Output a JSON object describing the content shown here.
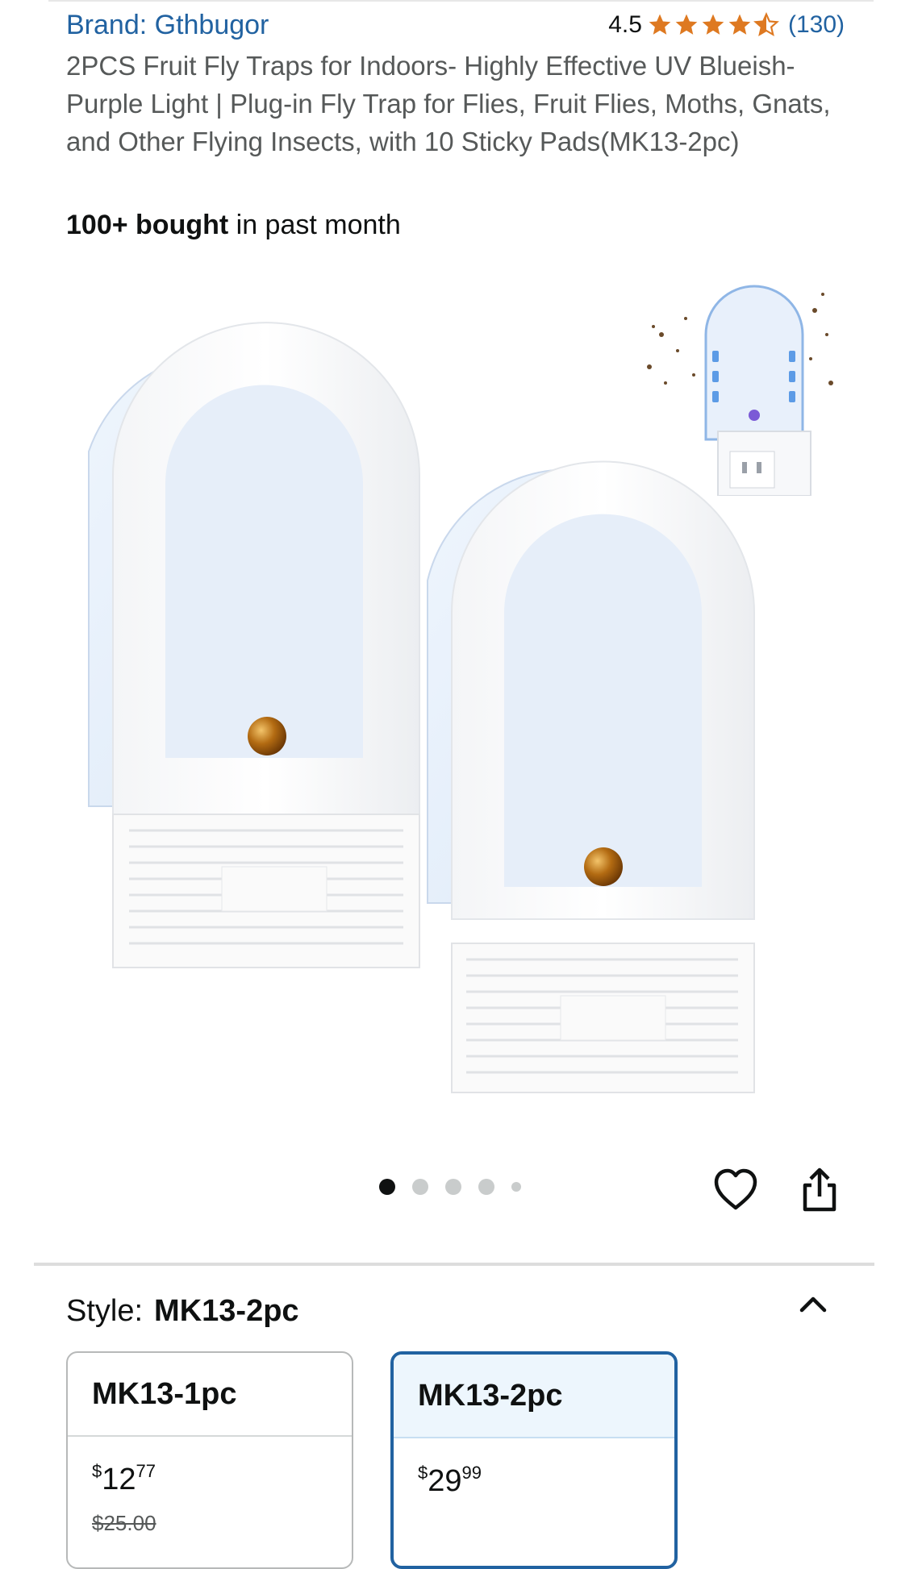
{
  "product": {
    "brand_label": "Brand: Gthbugor",
    "rating_value": "4.5",
    "rating_stars": 4.5,
    "review_count": "(130)",
    "title": "2PCS Fruit Fly Traps for Indoors- Highly Effective UV Blueish-Purple Light | Plug-in Fly Trap for Flies, Fruit Flies, Moths, Gnats, and Other Flying Insects, with 10 Sticky Pads(MK13-2pc)",
    "bought_bold": "100+ bought",
    "bought_rest": " in past month"
  },
  "gallery": {
    "image_count": 5,
    "active_index": 0
  },
  "style": {
    "label": "Style:",
    "selected": "MK13-2pc",
    "options": [
      {
        "name": "MK13-1pc",
        "price_currency": "$",
        "price_whole": "12",
        "price_fraction": "77",
        "was_price": "$25.00",
        "selected": false
      },
      {
        "name": "MK13-2pc",
        "price_currency": "$",
        "price_whole": "29",
        "price_fraction": "99",
        "was_price": "",
        "selected": true
      }
    ]
  },
  "colors": {
    "link": "#2162a1",
    "star": "#de7921",
    "selected_border": "#2162a1"
  },
  "icons": [
    "star-icon",
    "heart-icon",
    "share-icon",
    "chevron-up-icon"
  ]
}
